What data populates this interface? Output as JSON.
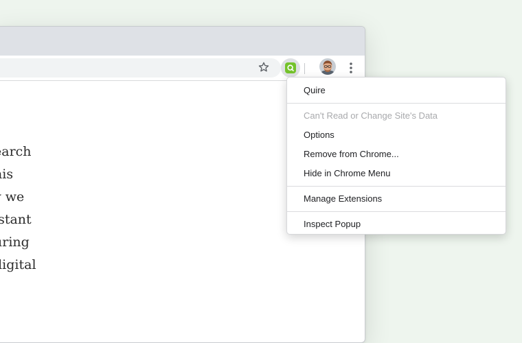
{
  "page": {
    "text_lines": [
      "earch",
      "his",
      "v we",
      "istant",
      "uring",
      " digital"
    ]
  },
  "extension_menu": {
    "items": [
      {
        "label": "Quire",
        "enabled": true
      },
      {
        "label": "Can't Read or Change Site's Data",
        "enabled": false
      },
      {
        "label": "Options",
        "enabled": true
      },
      {
        "label": "Remove from Chrome...",
        "enabled": true
      },
      {
        "label": "Hide in Chrome Menu",
        "enabled": true
      },
      {
        "label": "Manage Extensions",
        "enabled": true
      },
      {
        "label": "Inspect Popup",
        "enabled": true
      }
    ]
  },
  "toolbar": {
    "icons": [
      "star-icon",
      "quire-extension-icon",
      "profile-avatar",
      "kebab-menu-icon"
    ]
  },
  "colors": {
    "background": "#eef5ee",
    "tab_strip": "#dee1e6",
    "extension_green": "#75c32c",
    "disabled_text": "#a8a9ac"
  }
}
